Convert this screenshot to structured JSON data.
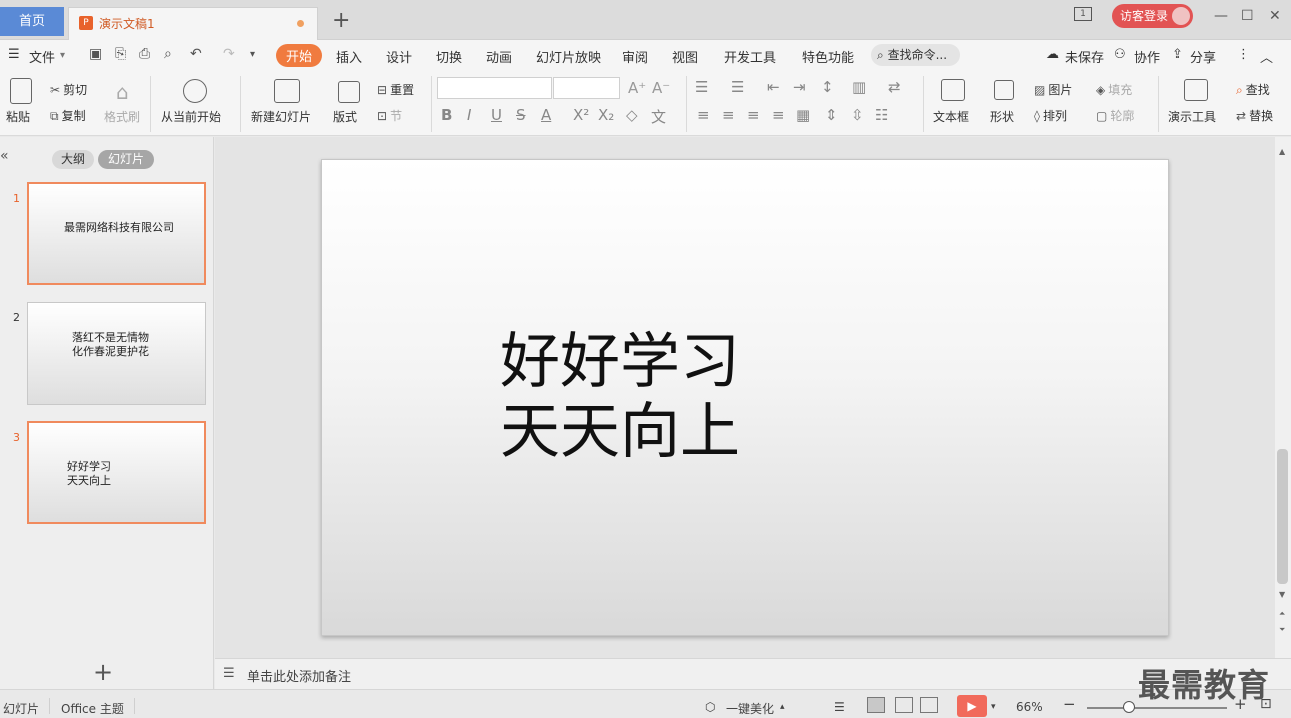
{
  "titlebar": {
    "home_tab": "首页",
    "doc_tab": "演示文稿1",
    "doc_icon": "P",
    "new_tab": "+",
    "page_badge": "1",
    "login": "访客登录"
  },
  "menu": {
    "file": "文件",
    "items": [
      "开始",
      "插入",
      "设计",
      "切换",
      "动画",
      "幻灯片放映",
      "审阅",
      "视图",
      "开发工具",
      "特色功能"
    ],
    "search": "查找命令...",
    "unsaved": "未保存",
    "collab": "协作",
    "share": "分享"
  },
  "ribbon": {
    "paste": "粘贴",
    "cut": "剪切",
    "copy": "复制",
    "format_painter": "格式刷",
    "from_current": "从当前开始",
    "new_slide": "新建幻灯片",
    "layout": "版式",
    "reset": "重置",
    "section": "节",
    "textbox": "文本框",
    "shape": "形状",
    "picture": "图片",
    "fill": "填充",
    "arrange": "排列",
    "outline": "轮廓",
    "present_tools": "演示工具",
    "find": "查找",
    "replace": "替换"
  },
  "leftpanel": {
    "outline_tab": "大纲",
    "slides_tab": "幻灯片",
    "thumbnails": [
      {
        "num": "1",
        "line1": "最需网络科技有限公司",
        "line2": ""
      },
      {
        "num": "2",
        "line1": "落红不是无情物",
        "line2": "化作春泥更护花"
      },
      {
        "num": "3",
        "line1": "好好学习",
        "line2": "天天向上"
      }
    ]
  },
  "slide": {
    "line1": "好好学习",
    "line2": "天天向上"
  },
  "notes": {
    "placeholder": "单击此处添加备注"
  },
  "statusbar": {
    "slide_label": "幻灯片",
    "theme": "Office 主题",
    "beautify": "一键美化",
    "zoom": "66%"
  },
  "watermark": "最需教育",
  "colors": {
    "accent": "#f07b3f",
    "home_tab": "#5a8ad6",
    "login": "#e25353",
    "play": "#f16a5b"
  }
}
